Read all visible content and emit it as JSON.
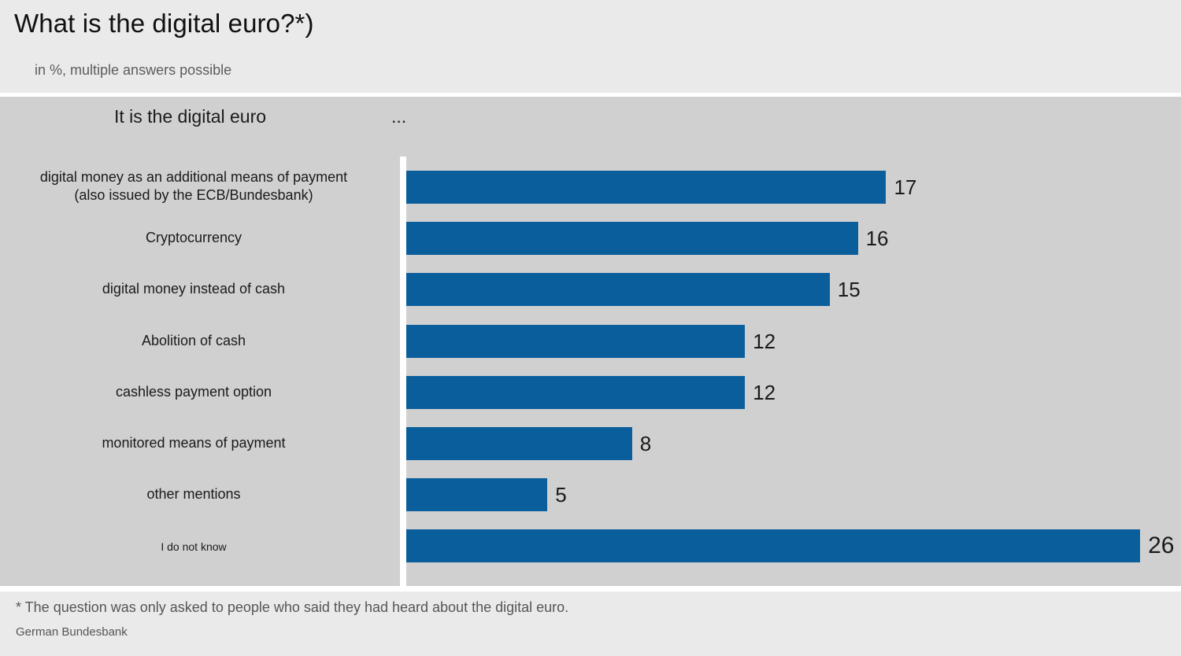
{
  "header": {
    "title": "What is the digital euro?*)",
    "subtitle": "in %, multiple answers possible"
  },
  "chart_header": {
    "prefix": "It is the digital euro",
    "ellipsis": "..."
  },
  "footer": {
    "footnote": "* The question was only asked to people who said they had heard about the digital euro.",
    "source": "German Bundesbank"
  },
  "colors": {
    "bar": "#0a5e9c",
    "header_band": "#eaeaea",
    "plot_background": "#d0d0d0",
    "axis": "#ffffff",
    "title_text": "#101010",
    "subtitle_text": "#5d5d5d",
    "footer_text": "#555555"
  },
  "chart_data": {
    "type": "bar",
    "orientation": "horizontal",
    "title": "What is the digital euro?*)",
    "subtitle": "in %, multiple answers possible",
    "xlabel": "",
    "ylabel": "",
    "unit": "%",
    "xlim": [
      0,
      28
    ],
    "grid": false,
    "legend": null,
    "annotation": "* The question was only asked to people who said they had heard about the digital euro.",
    "source": "German Bundesbank",
    "categories": [
      "digital money as an additional means of payment\n(also issued by the ECB/Bundesbank)",
      "Cryptocurrency",
      "digital money instead of cash",
      "Abolition of cash",
      "cashless payment option",
      "monitored means of payment",
      "other mentions",
      "I do not know"
    ],
    "values": [
      17,
      16,
      15,
      12,
      12,
      8,
      5,
      26
    ],
    "value_labels": [
      "17",
      "16",
      "15",
      "12",
      "12",
      "8",
      "5",
      "26"
    ]
  }
}
